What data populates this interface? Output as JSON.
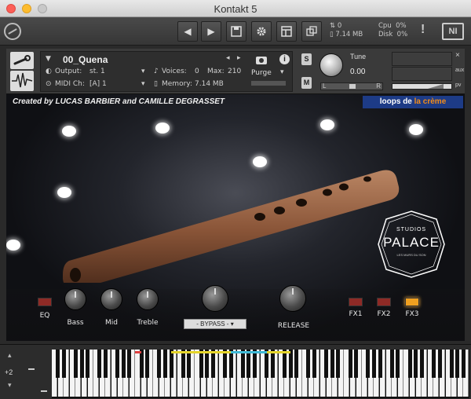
{
  "window": {
    "title": "Kontakt 5"
  },
  "toolbar": {
    "prev_label": "◀",
    "next_label": "▶",
    "save_label": "💾",
    "gear_label": "⚙",
    "view_label": "▦",
    "rack_label": "⧉",
    "midi_count": "0",
    "memory": "7.14 MB",
    "cpu_label": "Cpu",
    "cpu_value": "0%",
    "disk_label": "Disk",
    "disk_value": "0%",
    "alert_label": "!",
    "ni_label": "NI"
  },
  "instrument": {
    "name": "00_Quena",
    "output_label": "Output:",
    "output_value": "st. 1",
    "voices_label": "Voices:",
    "voices_value": "0",
    "max_label": "Max:",
    "max_value": "210",
    "purge_label": "Purge",
    "midi_label": "MIDI Ch:",
    "midi_value": "[A] 1",
    "memory_label": "Memory:",
    "memory_value": "7.14 MB",
    "solo_label": "S",
    "mute_label": "M",
    "tune_label": "Tune",
    "tune_value": "0.00",
    "pan_left": "L",
    "pan_right": "R",
    "close_label": "×",
    "aux_label": "aux",
    "pv_label": "pv"
  },
  "artwork": {
    "credit": "Created by  LUCAS BARBIER and CAMILLE DEGRASSET",
    "brand_prefix": "loops de ",
    "brand_la": "la ",
    "brand_creme": "crème",
    "studio_small": "STUDIOS",
    "studio_name": "PALACE",
    "studio_tag": "LES MURS DU SON"
  },
  "controls": {
    "eq_label": "EQ",
    "bass_label": "Bass",
    "mid_label": "Mid",
    "treble_label": "Treble",
    "bypass_label": "- BYPASS -",
    "release_label": "RELEASE",
    "fx1_label": "FX1",
    "fx2_label": "FX2",
    "fx3_label": "FX3"
  },
  "keyboard": {
    "octave_label": "+2"
  },
  "colors": {
    "accent_orange": "#f28c1a",
    "brand_blue": "#1d3b86",
    "led_on": "#f0a020",
    "led_off": "#8e2a26"
  }
}
